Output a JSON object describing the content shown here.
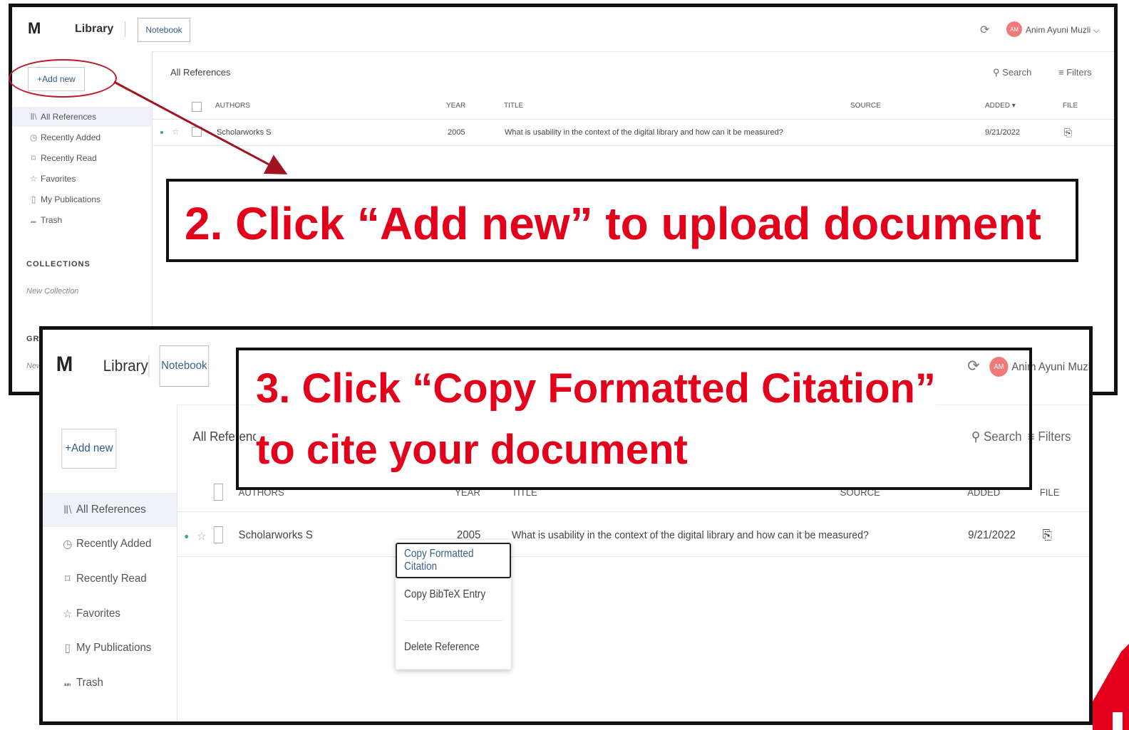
{
  "app": {
    "title": "Library",
    "notebook_label": "Notebook",
    "user_name": "Anim Ayuni Muzli",
    "user_initials": "AM",
    "add_new_label": "+Add new",
    "pane_title": "All References",
    "search_label": "Search",
    "filters_label": "Filters",
    "colors": {
      "accent_red": "#e3001b",
      "avatar": "#f07a7a",
      "active_bg": "#eef2f8"
    }
  },
  "sidebar": {
    "items": [
      {
        "label": "All References",
        "icon": "library-icon"
      },
      {
        "label": "Recently Added",
        "icon": "clock-icon"
      },
      {
        "label": "Recently Read",
        "icon": "bookmark-icon"
      },
      {
        "label": "Favorites",
        "icon": "star-icon"
      },
      {
        "label": "My Publications",
        "icon": "document-icon"
      },
      {
        "label": "Trash",
        "icon": "trash-icon"
      }
    ],
    "collections_heading": "COLLECTIONS",
    "new_collection": "New Collection",
    "groups_heading_partial": "GR",
    "groups_new_partial": "New"
  },
  "table": {
    "columns_1": [
      "AUTHORS",
      "YEAR",
      "TITLE",
      "SOURCE",
      "ADDED",
      "FILE"
    ],
    "columns_2": [
      "AUTHORS",
      "YEAR",
      "TITLE",
      "SOURCE",
      "ADDED",
      "FILE"
    ],
    "row": {
      "author": "Scholarworks S",
      "year": "2005",
      "title": "What is usability in the context of the digital library and how can it be measured?",
      "added": "9/21/2022"
    }
  },
  "context_menu": {
    "items": [
      "Copy Formatted Citation",
      "Copy BibTeX Entry",
      "Delete Reference"
    ]
  },
  "callouts": {
    "step2": "2. Click “Add new” to upload document",
    "step3_line1": "3. Click “Copy Formatted Citation”",
    "step3_line2": "to cite your document"
  }
}
